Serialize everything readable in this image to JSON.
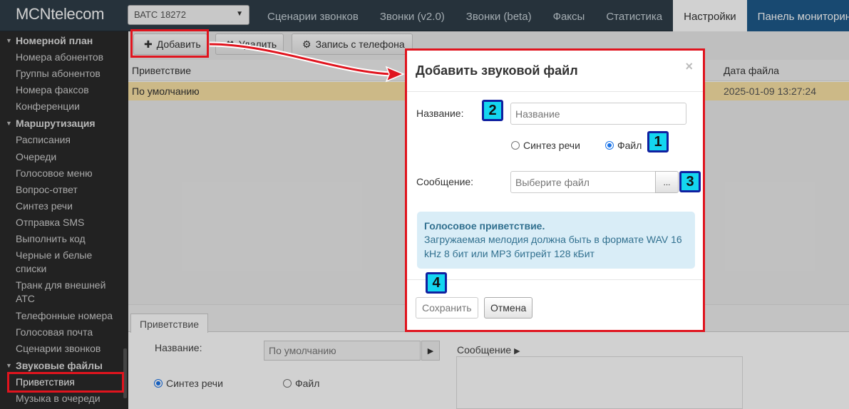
{
  "app": {
    "logo": "MCNtelecom",
    "pbx_select": "ВАТС 18272"
  },
  "top_tabs": [
    {
      "label": "Сценарии звонков"
    },
    {
      "label": "Звонки (v2.0)"
    },
    {
      "label": "Звонки (beta)"
    },
    {
      "label": "Факсы"
    },
    {
      "label": "Статистика"
    },
    {
      "label": "Настройки"
    },
    {
      "label": "Панель мониторинга"
    }
  ],
  "sidebar": {
    "items": [
      {
        "label": "Номерной план"
      },
      {
        "label": "Номера абонентов"
      },
      {
        "label": "Группы абонентов"
      },
      {
        "label": "Номера факсов"
      },
      {
        "label": "Конференции"
      },
      {
        "label": "Маршрутизация"
      },
      {
        "label": "Расписания"
      },
      {
        "label": "Очереди"
      },
      {
        "label": "Голосовое меню"
      },
      {
        "label": "Вопрос-ответ"
      },
      {
        "label": "Синтез речи"
      },
      {
        "label": "Отправка SMS"
      },
      {
        "label": "Выполнить код"
      },
      {
        "label": "Черные и белые списки"
      },
      {
        "label": "Транк для внешней АТС"
      },
      {
        "label": "Телефонные номера"
      },
      {
        "label": "Голосовая почта"
      },
      {
        "label": "Сценарии звонков"
      },
      {
        "label": "Звуковые файлы"
      },
      {
        "label": "Приветствия"
      },
      {
        "label": "Музыка в очереди"
      }
    ]
  },
  "toolbar": {
    "add_label": "Добавить",
    "delete_label": "Удалить",
    "record_label": "Запись с телефона"
  },
  "grid": {
    "columns": [
      "Приветствие",
      "Дата файла"
    ],
    "rows": [
      {
        "name": "По умолчанию",
        "date": "2025-01-09 13:27:24"
      }
    ]
  },
  "bottom_panel": {
    "tab": "Приветствие",
    "name_label": "Название:",
    "name_value": "По умолчанию",
    "message_label": "Сообщение",
    "radio_tts": "Синтез речи",
    "radio_file": "Файл"
  },
  "modal": {
    "title": "Добавить звуковой файл",
    "close": "×",
    "name_label": "Название:",
    "name_placeholder": "Название",
    "radio_tts": "Синтез речи",
    "radio_file": "Файл",
    "message_label": "Сообщение:",
    "file_placeholder": "Выберите файл",
    "browse_label": "...",
    "info_title": "Голосовое приветствие.",
    "info_text": "Загружаемая мелодия должна быть в формате WAV 16 kHz 8 бит или MP3 битрейт 128 кБит",
    "save_label": "Сохранить",
    "cancel_label": "Отмена"
  },
  "markers": [
    "1",
    "2",
    "3",
    "4"
  ],
  "colors": {
    "topbar": "#2f3d48",
    "sidebar": "#2a2a2a",
    "highlight": "#e0141e",
    "marker_fill": "#14d6f0",
    "marker_border": "#1020a0",
    "selected_row": "#f9e2a5",
    "info_bg": "#d9edf7"
  }
}
